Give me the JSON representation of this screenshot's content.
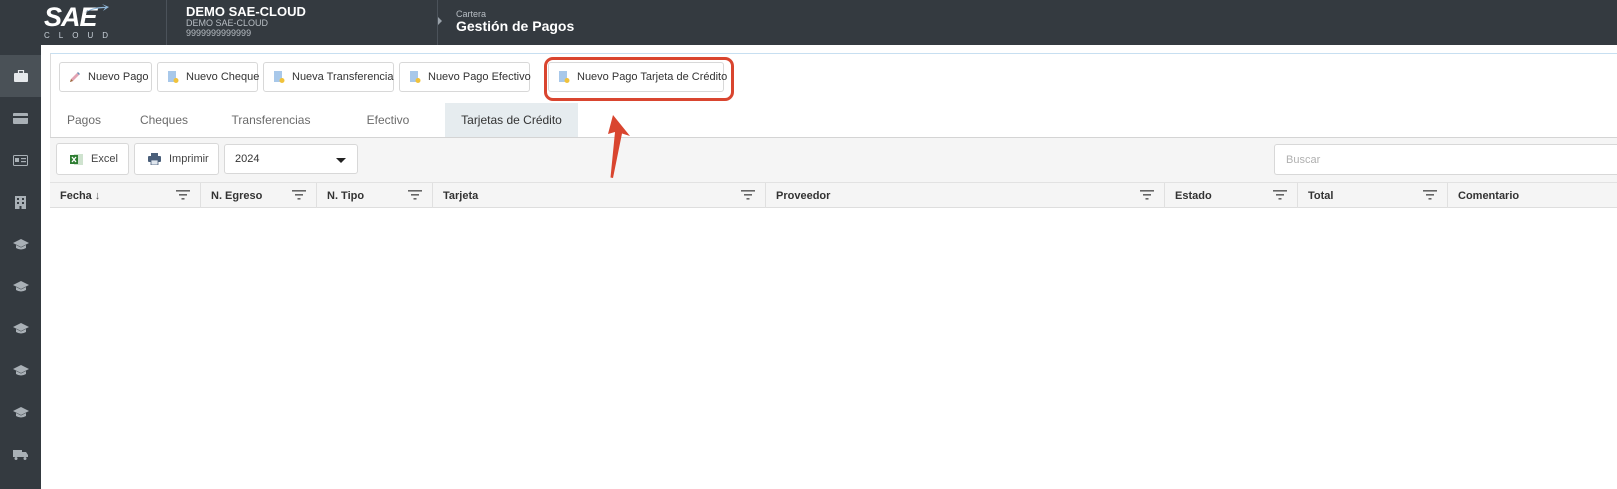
{
  "topbar": {
    "logo_main": "SAE",
    "logo_sub": "CLOUD",
    "company_name": "DEMO SAE-CLOUD",
    "company_sub": "DEMO SAE-CLOUD",
    "company_id": "9999999999999",
    "breadcrumb": "Cartera",
    "page_title": "Gestión de Pagos"
  },
  "sidebar": {
    "items": [
      {
        "icon": "briefcase-icon",
        "active": true
      },
      {
        "icon": "credit-card-icon",
        "active": false
      },
      {
        "icon": "id-card-icon",
        "active": false
      },
      {
        "icon": "building-icon",
        "active": false
      },
      {
        "icon": "graduation-cap-icon",
        "active": false
      },
      {
        "icon": "graduation-cap-icon",
        "active": false
      },
      {
        "icon": "graduation-cap-icon",
        "active": false
      },
      {
        "icon": "graduation-cap-icon",
        "active": false
      },
      {
        "icon": "graduation-cap-icon",
        "active": false
      },
      {
        "icon": "truck-icon",
        "active": false
      }
    ]
  },
  "toolbar": {
    "buttons": [
      {
        "label": "Nuevo Pago",
        "icon": "pen-icon"
      },
      {
        "label": "Nuevo Cheque",
        "icon": "document-icon"
      },
      {
        "label": "Nueva Transferencia",
        "icon": "document-icon"
      },
      {
        "label": "Nuevo Pago Efectivo",
        "icon": "document-icon"
      },
      {
        "label": "Nuevo Pago Tarjeta de Crédito",
        "icon": "document-icon"
      }
    ],
    "highlight_color": "#d9452f"
  },
  "tabs": [
    {
      "label": "Pagos",
      "active": false
    },
    {
      "label": "Cheques",
      "active": false
    },
    {
      "label": "Transferencias",
      "active": false
    },
    {
      "label": "Efectivo",
      "active": false
    },
    {
      "label": "Tarjetas de Crédito",
      "active": true
    }
  ],
  "grid_toolbar": {
    "excel_label": "Excel",
    "print_label": "Imprimir",
    "year_value": "2024",
    "search_placeholder": "Buscar"
  },
  "columns": [
    {
      "label": "Fecha",
      "sort": "↓"
    },
    {
      "label": "N. Egreso"
    },
    {
      "label": "N. Tipo"
    },
    {
      "label": "Tarjeta"
    },
    {
      "label": "Proveedor"
    },
    {
      "label": "Estado"
    },
    {
      "label": "Total"
    },
    {
      "label": "Comentario"
    }
  ],
  "rows": [],
  "colors": {
    "topbar": "#343a40",
    "sidebar": "#343a40",
    "active_tab": "#e6ecef",
    "annotation": "#d9452f"
  }
}
